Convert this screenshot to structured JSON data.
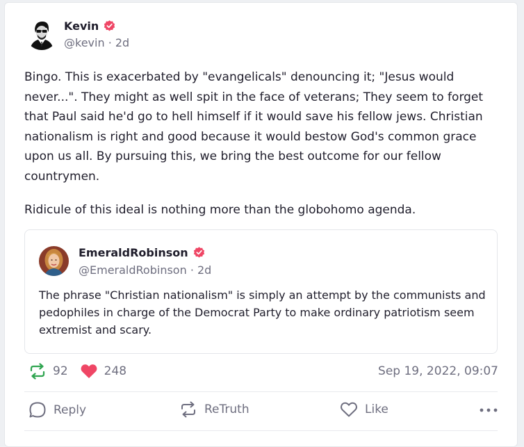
{
  "post": {
    "author_name": "Kevin",
    "author_handle": "@kevin",
    "age": "· 2d",
    "paragraphs": [
      "Bingo. This is exacerbated by \"evangelicals\" denouncing it; \"Jesus would never...\". They might as well spit in the face of veterans; They seem to forget that Paul said he'd go to hell himself if it would save his fellow jews. Christian nationalism is right and good because it would bestow God's common grace upon us all. By pursuing this, we bring the best outcome for our fellow countrymen.",
      "Ridicule of this ideal is nothing more than the globohomo agenda."
    ]
  },
  "quoted": {
    "author_name": "EmeraldRobinson",
    "author_handle": "@EmeraldRobinson",
    "age": "· 2d",
    "text": "The phrase \"Christian nationalism\" is simply an attempt by the communists and pedophiles in charge of the Democrat Party to make ordinary patriotism seem extremist and scary."
  },
  "stats": {
    "retruths": "92",
    "likes": "248",
    "timestamp": "Sep 19, 2022, 09:07"
  },
  "actions": {
    "reply": "Reply",
    "retruth": "ReTruth",
    "like": "Like"
  },
  "colors": {
    "verified": "#ef4665",
    "retruth_green": "#2ea44f",
    "like_pink": "#ef4665",
    "muted": "#6e6e7f"
  },
  "icons": {
    "verified": "verified-badge-icon",
    "retruth": "retruth-icon",
    "heart": "heart-icon",
    "reply": "reply-icon",
    "more": "more-icon"
  }
}
